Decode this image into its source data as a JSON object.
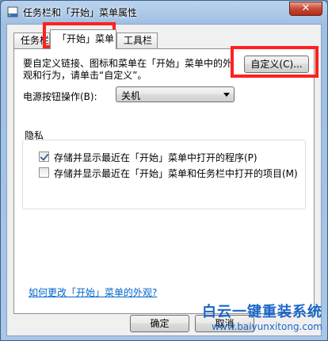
{
  "window": {
    "title": "任务栏和「开始」菜单属性",
    "close_label": "✕"
  },
  "tabs": [
    {
      "label": "任务栏"
    },
    {
      "label": "「开始」菜单"
    },
    {
      "label": "工具栏"
    }
  ],
  "start_menu": {
    "description": "要自定义链接、图标和菜单在「开始」菜单中的外观和行为，请单击“自定义”。",
    "customize_button": "自定义(C)...",
    "power_label": "电源按钮操作(B):",
    "power_value": "关机",
    "privacy": {
      "title": "隐私",
      "items": [
        {
          "label": "存储并显示最近在「开始」菜单中打开的程序(P)",
          "checked": true
        },
        {
          "label": "存储并显示最近在「开始」菜单和任务栏中打开的项目(M)",
          "checked": false
        }
      ]
    },
    "help_link": "如何更改「开始」菜单的外观?"
  },
  "footer": {
    "ok": "确定",
    "cancel": "取消"
  },
  "watermark": {
    "title": "白云一键重装系统",
    "url": "www.baiyunxitong.com"
  },
  "colors": {
    "highlight": "#ff2020",
    "link": "#0066cc",
    "watermark": "#1a66c8"
  }
}
